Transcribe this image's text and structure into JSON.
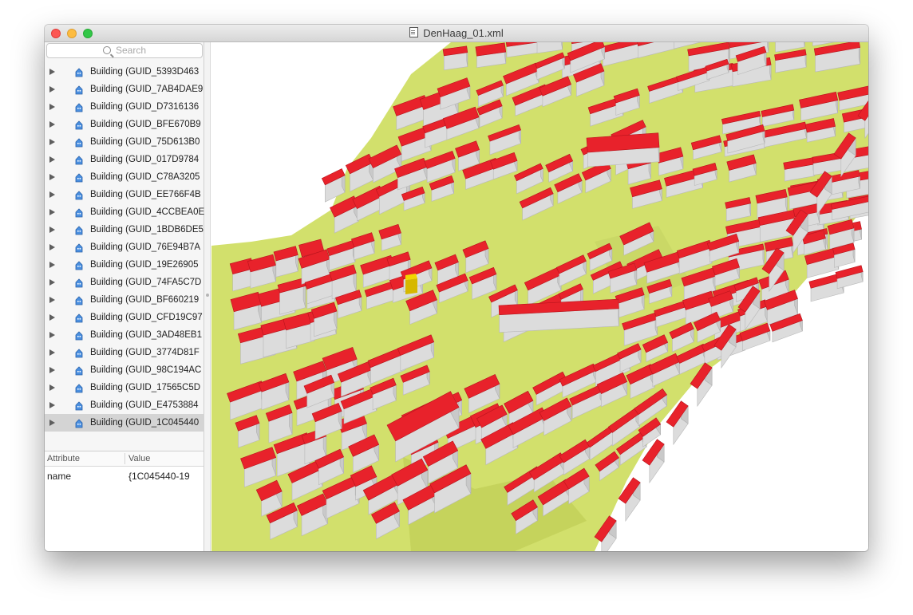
{
  "window": {
    "title": "DenHaag_01.xml"
  },
  "search": {
    "placeholder": "Search"
  },
  "tree": {
    "items": [
      {
        "label": "Building (GUID_5393D463"
      },
      {
        "label": "Building (GUID_7AB4DAE9"
      },
      {
        "label": "Building (GUID_D7316136"
      },
      {
        "label": "Building (GUID_BFE670B9"
      },
      {
        "label": "Building (GUID_75D613B0"
      },
      {
        "label": "Building (GUID_017D9784"
      },
      {
        "label": "Building (GUID_C78A3205"
      },
      {
        "label": "Building (GUID_EE766F4B"
      },
      {
        "label": "Building (GUID_4CCBEA0E"
      },
      {
        "label": "Building (GUID_1BDB6DE5"
      },
      {
        "label": "Building (GUID_76E94B7A"
      },
      {
        "label": "Building (GUID_19E26905"
      },
      {
        "label": "Building (GUID_74FA5C7D"
      },
      {
        "label": "Building (GUID_BF660219"
      },
      {
        "label": "Building (GUID_CFD19C97"
      },
      {
        "label": "Building (GUID_3AD48EB1"
      },
      {
        "label": "Building (GUID_3774D81F"
      },
      {
        "label": "Building (GUID_98C194AC"
      },
      {
        "label": "Building (GUID_17565C5D"
      },
      {
        "label": "Building (GUID_E4753884"
      },
      {
        "label": "Building (GUID_1C045440"
      }
    ],
    "selected_index": 20
  },
  "attributes": {
    "header_attribute": "Attribute",
    "header_value": "Value",
    "rows": [
      {
        "attribute": "name",
        "value": "{1C045440-19"
      }
    ]
  },
  "colors": {
    "roof": "#e8222b",
    "wall": "#dcdcdc",
    "ground": "#d2e06c",
    "highlight": "#f2d600"
  }
}
